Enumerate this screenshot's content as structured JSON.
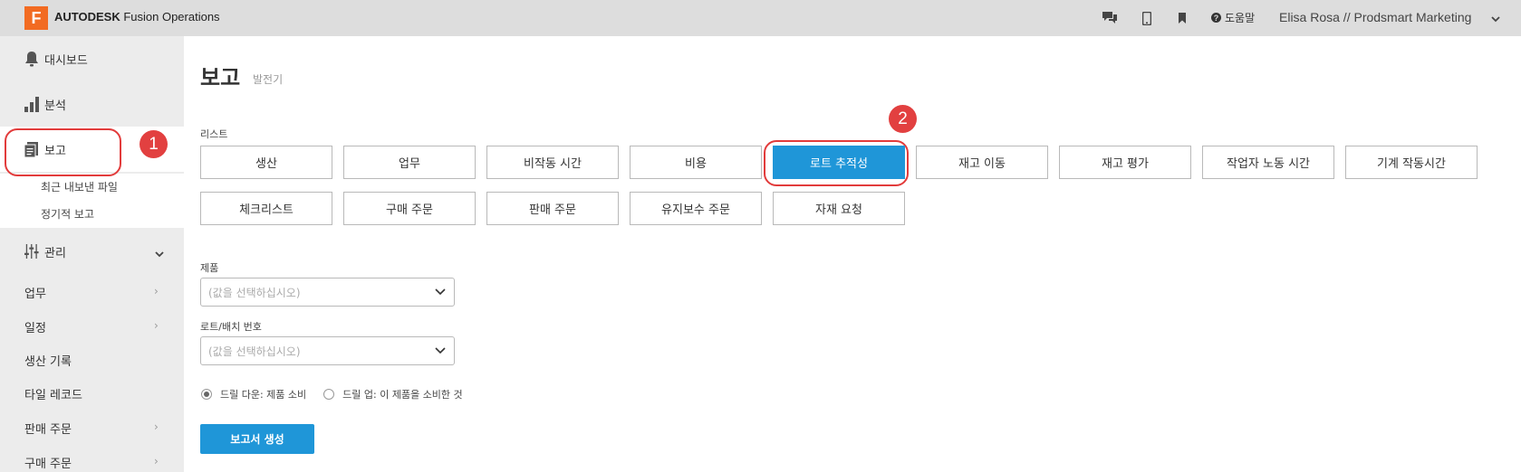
{
  "topbar": {
    "logo_letter": "F",
    "brand_bold": "AUTODESK",
    "brand_rest": " Fusion Operations",
    "icons": [
      "chat-icon",
      "mobile-icon",
      "bookmark-icon"
    ],
    "help_label": "도움말",
    "user_label": "Elisa Rosa // Prodsmart Marketing"
  },
  "sidebar": {
    "dashboard": "대시보드",
    "analytics": "분석",
    "reports": "보고",
    "recent_exports": "최근 내보낸 파일",
    "scheduled_reports": "정기적 보고",
    "manage": "관리",
    "nav": [
      "업무",
      "일정",
      "생산 기록",
      "타일 레코드",
      "판매 주문",
      "구매 주문"
    ]
  },
  "annotations": {
    "badge1": "1",
    "badge2": "2"
  },
  "main": {
    "title": "보고",
    "subtitle": "발전기",
    "list_label": "리스트",
    "report_types_row1": [
      "생산",
      "업무",
      "비작동 시간",
      "비용",
      "로트 추적성",
      "재고 이동",
      "재고 평가",
      "작업자 노동 시간",
      "기계 작동시간"
    ],
    "report_types_row2": [
      "체크리스트",
      "구매 주문",
      "판매 주문",
      "유지보수 주문",
      "자재 요청"
    ],
    "selected_report": "로트 추적성",
    "product_label": "제품",
    "product_placeholder": "(값을 선택하십시오)",
    "lot_label": "로트/배치 번호",
    "lot_placeholder": "(값을 선택하십시오)",
    "drill_down": "드릴 다운: 제품 소비",
    "drill_up": "드릴 업: 이 제품을 소비한 것",
    "generate_button": "보고서 생성"
  },
  "colors": {
    "accent": "#1f96d8",
    "annotation": "#e24040",
    "logo": "#f26b22"
  }
}
